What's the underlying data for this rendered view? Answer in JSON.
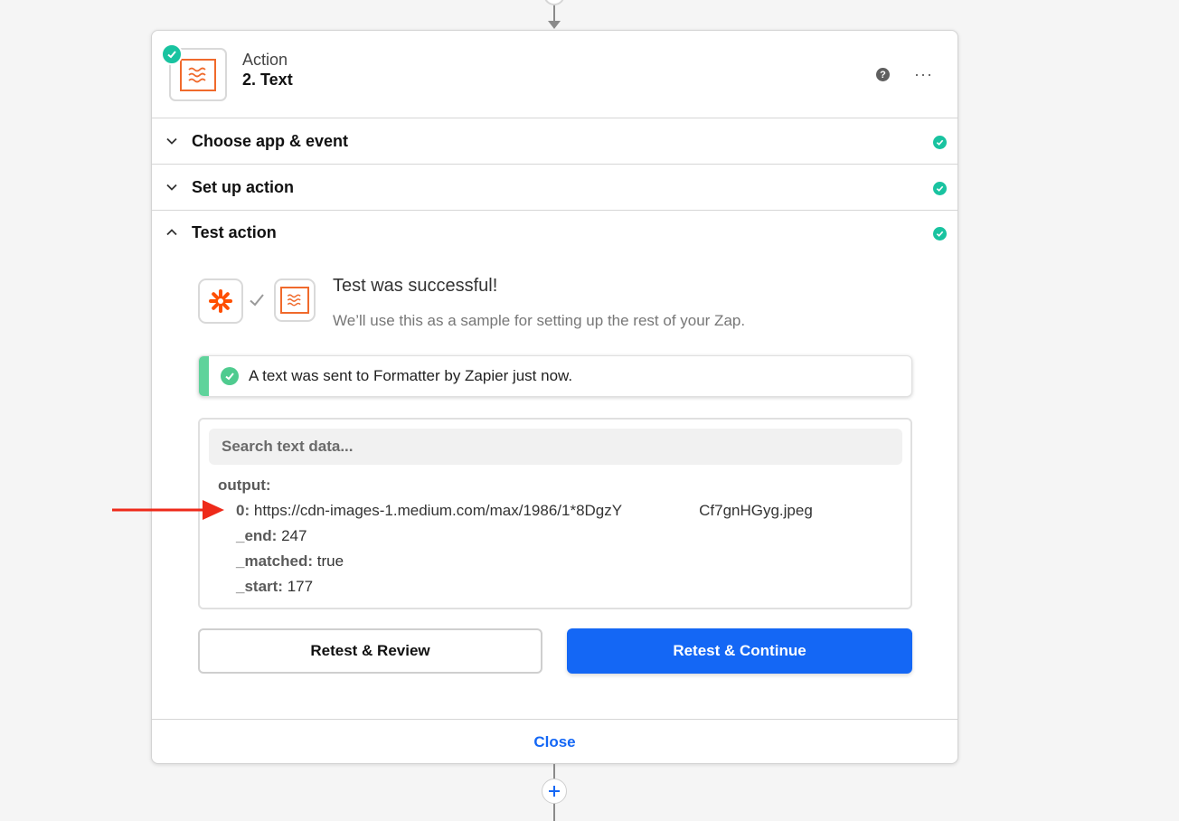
{
  "step": {
    "kind": "Action",
    "title": "2. Text",
    "app_icon": "formatter-icon",
    "status": "complete"
  },
  "header_actions": {
    "help_label": "?",
    "more_label": "···"
  },
  "sections": {
    "choose": {
      "label": "Choose app & event",
      "expanded": false
    },
    "setup": {
      "label": "Set up action",
      "expanded": false
    },
    "test": {
      "label": "Test action",
      "expanded": true
    }
  },
  "test": {
    "success_title": "Test was successful!",
    "success_subtitle": "We’ll use this as a sample for setting up the rest of your Zap.",
    "alert_text": "A text was sent to Formatter by Zapier just now.",
    "search_placeholder": "Search text data...",
    "output": {
      "label": "output:",
      "rows": [
        {
          "key": "0:",
          "value": "https://cdn-images-1.medium.com/max/1986/1*8DgzY                  Cf7gnHGyg.jpeg"
        },
        {
          "key": "_end:",
          "value": "247"
        },
        {
          "key": "_matched:",
          "value": "true"
        },
        {
          "key": "_start:",
          "value": "177"
        }
      ]
    },
    "buttons": {
      "review": "Retest & Review",
      "continue": "Retest & Continue"
    }
  },
  "footer": {
    "close_label": "Close"
  },
  "colors": {
    "primary": "#1467f5",
    "success": "#19c3a0",
    "formatter_orange": "#f06a2c",
    "zapier_orange": "#ff4f00",
    "annotation_red": "#ee2a1a"
  }
}
